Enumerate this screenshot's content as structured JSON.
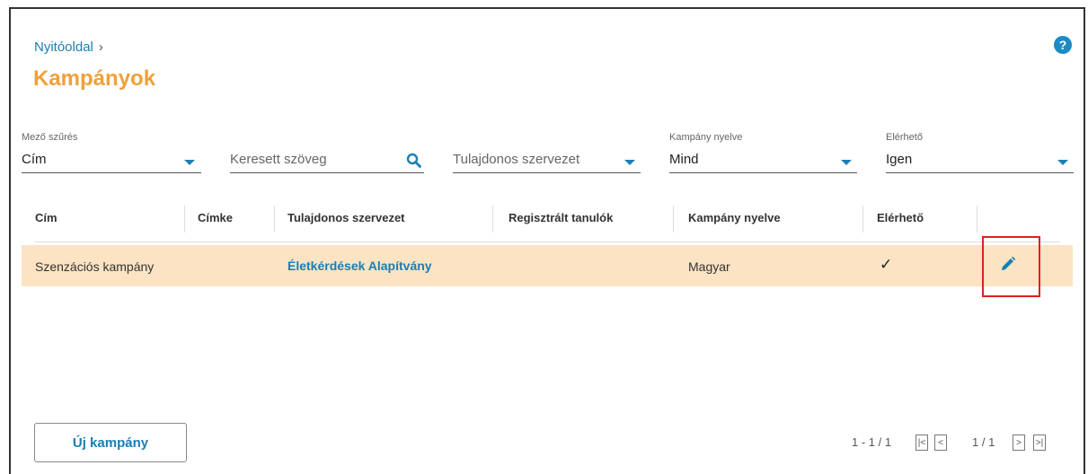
{
  "breadcrumb": {
    "home": "Nyitóoldal",
    "separator": "›"
  },
  "page": {
    "title": "Kampányok",
    "help": "?"
  },
  "filters": {
    "field": {
      "label": "Mező szűrés",
      "value": "Cím"
    },
    "search": {
      "placeholder": "Keresett szöveg"
    },
    "owner": {
      "placeholder": "Tulajdonos szervezet"
    },
    "language": {
      "label": "Kampány nyelve",
      "value": "Mind"
    },
    "available": {
      "label": "Elérhető",
      "value": "Igen"
    }
  },
  "table": {
    "columns": [
      "Cím",
      "Címke",
      "Tulajdonos szervezet",
      "Regisztrált tanulók",
      "Kampány nyelve",
      "Elérhető"
    ],
    "rows": [
      {
        "title": "Szenzációs kampány",
        "label": "",
        "owner": "Életkérdések Alapítvány",
        "registered": "",
        "language": "Magyar",
        "available": "✓"
      }
    ]
  },
  "actions": {
    "new_campaign": "Új kampány"
  },
  "pagination": {
    "range": "1 - 1 / 1",
    "page": "1 / 1",
    "first": "|<",
    "prev": "<",
    "next": ">",
    "last": ">|"
  },
  "colors": {
    "accent": "#1a7fb4",
    "title": "#f0a03a",
    "row_highlight": "#fbe3c3",
    "callout": "#e02020"
  }
}
